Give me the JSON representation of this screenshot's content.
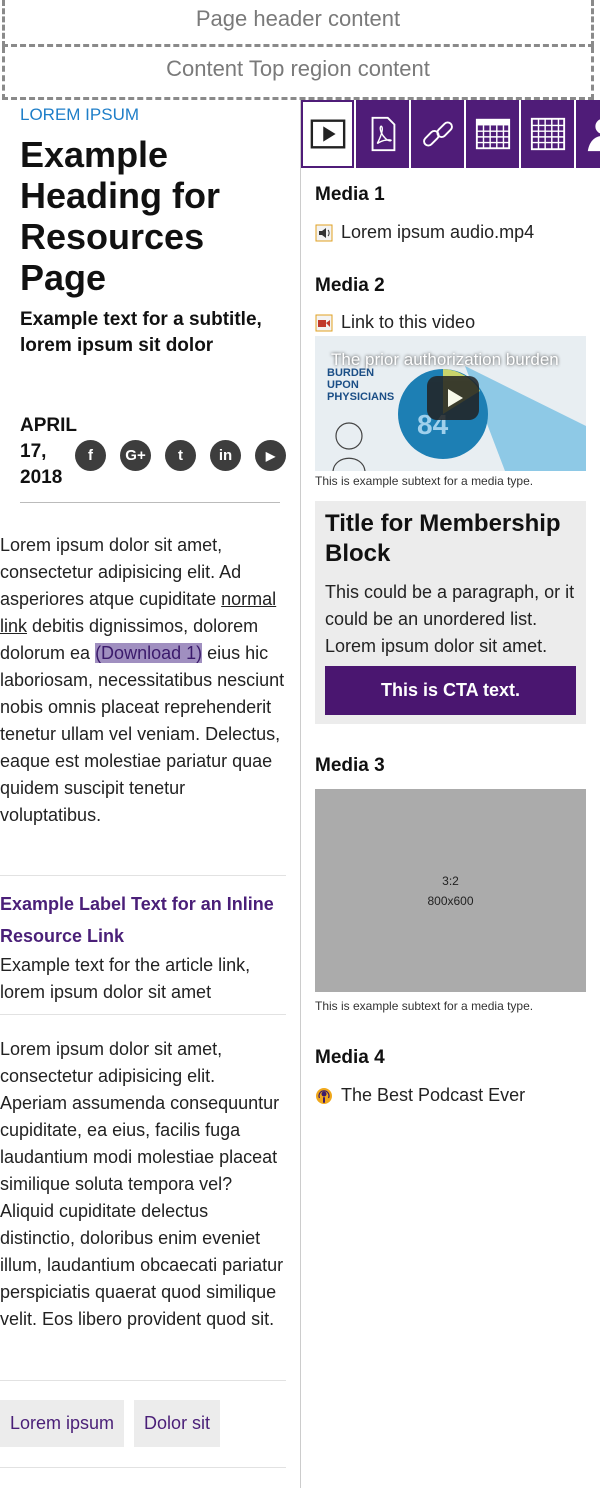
{
  "regions": {
    "header": "Page header content",
    "content_top": "Content Top region content"
  },
  "article": {
    "eyebrow": "LOREM IPSUM",
    "title": "Example Heading for Resources Page",
    "subtitle": "Example text for a subtitle, lorem ipsum sit dolor",
    "date": "APRIL 17, 2018",
    "social_icons": [
      "facebook-icon",
      "google-plus-icon",
      "twitter-icon",
      "linkedin-icon",
      "youtube-icon"
    ],
    "social_glyphs": [
      "f",
      "G+",
      "t",
      "in",
      "▶"
    ],
    "para1_a": "Lorem ipsum dolor sit amet, consectetur adipisicing elit. Ad asperiores atque cupiditate ",
    "para1_link": "normal link",
    "para1_b": " debitis dignissimos, dolorem dolorum ea ",
    "para1_download": "(Download 1)",
    "para1_c": " eius hic laboriosam, necessitatibus nesciunt nobis omnis placeat reprehenderit tenetur ullam vel veniam. Delectus, eaque est molestiae pariatur quae quidem suscipit tenetur voluptatibus.",
    "inline_label": "Example Label Text for an Inline Resource Link",
    "inline_text": "Example text for the article link, lorem ipsum dolor sit amet",
    "para2": "Lorem ipsum dolor sit amet, consectetur adipisicing elit. Aperiam assumenda consequuntur cupiditate, ea eius, facilis fuga laudantium modi molestiae placeat similique soluta tempora vel? Aliquid cupiditate delectus distinctio, doloribus enim eveniet illum, laudantium obcaecati pariatur perspiciatis quaerat quod similique velit. Eos libero provident quod sit.",
    "tags": [
      "Lorem ipsum",
      "Dolor sit"
    ]
  },
  "tabs": [
    "video-tab",
    "pdf-tab",
    "link-tab",
    "calendar-tab",
    "table-tab",
    "person-tab"
  ],
  "media": {
    "m1_heading": "Media 1",
    "m1_item": "Lorem ipsum audio.mp4",
    "m2_heading": "Media 2",
    "m2_item": "Link to this video",
    "video_title": "The prior authorization burden",
    "subtext": "This is example subtext for a media type.",
    "membership_title": "Title for Membership Block",
    "membership_text": "This could be a paragraph, or it could be an unordered list. Lorem ipsum dolor sit amet.",
    "cta": "This is CTA text.",
    "m3_heading": "Media 3",
    "placeholder_ratio": "3:2",
    "placeholder_size": "800x600",
    "m4_heading": "Media 4",
    "m4_item": "The Best Podcast Ever"
  },
  "colors": {
    "brand_purple": "#4f1c78",
    "link_blue": "#1e7ec8"
  }
}
